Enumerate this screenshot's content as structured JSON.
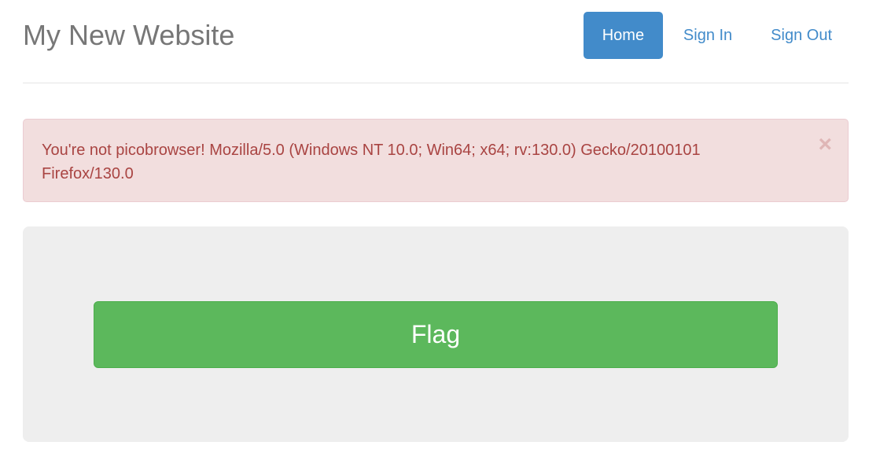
{
  "header": {
    "site_title": "My New Website",
    "nav": {
      "home_label": "Home",
      "sign_in_label": "Sign In",
      "sign_out_label": "Sign Out",
      "active_item": "Home"
    }
  },
  "alert": {
    "message": "You're not picobrowser! Mozilla/5.0 (Windows NT 10.0; Win64; x64; rv:130.0) Gecko/20100101 Firefox/130.0",
    "close_symbol": "×",
    "type": "danger"
  },
  "main": {
    "flag_button_label": "Flag"
  },
  "colors": {
    "primary": "#428bca",
    "success": "#5cb85c",
    "danger_text": "#a94442",
    "danger_bg": "#f2dede",
    "jumbotron_bg": "#eeeeee"
  }
}
